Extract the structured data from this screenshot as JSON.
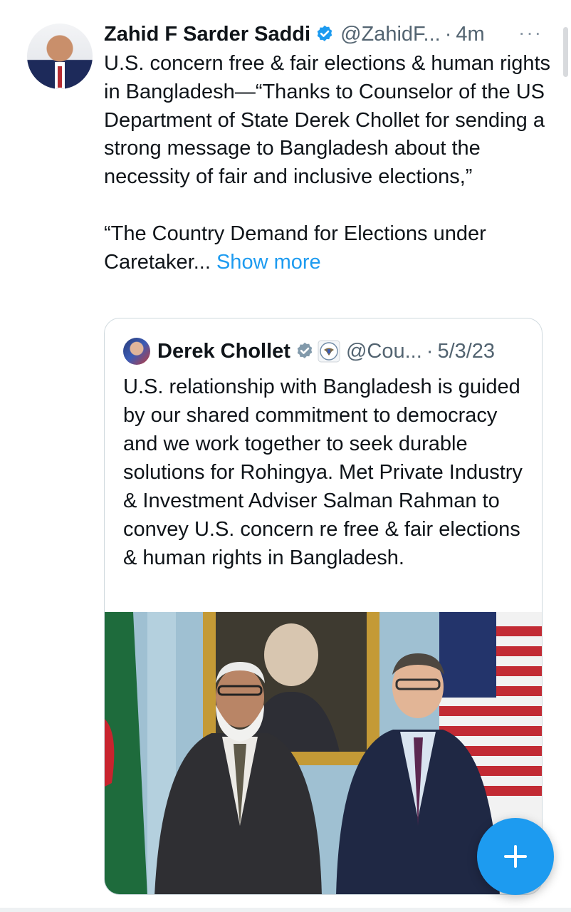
{
  "tweet": {
    "author_name": "Zahid F Sarder Saddi",
    "handle": "@ZahidF...",
    "separator": "·",
    "time": "4m",
    "more_menu": "···",
    "text": "U.S. concern free & fair elections & human rights in Bangladesh—“Thanks to Counselor of the US Department of State Derek Chollet for sending a strong message to Bangladesh about the necessity of fair and inclusive elections,”\n\n“The Country Demand for Elections under Caretaker... ",
    "show_more": "Show more"
  },
  "quote": {
    "author_name": "Derek Chollet",
    "handle": "@Cou...",
    "separator": "·",
    "date": "5/3/23",
    "text": "U.S. relationship with Bangladesh is guided by our shared commitment to democracy and we work together to seek durable solutions for Rohingya. Met Private Industry & Investment Adviser Salman Rahman to convey U.S. concern re free & fair elections & human rights in Bangladesh."
  },
  "colors": {
    "accent": "#1d9bf0",
    "secondary_text": "#536471",
    "verified_badge": "#1d9bf0",
    "gov_badge": "#829aab"
  },
  "icons": {
    "verified": "verified-badge-icon",
    "government_seal": "us-state-department-seal-icon",
    "compose": "plus-icon",
    "more": "more-horizontal-icon"
  }
}
